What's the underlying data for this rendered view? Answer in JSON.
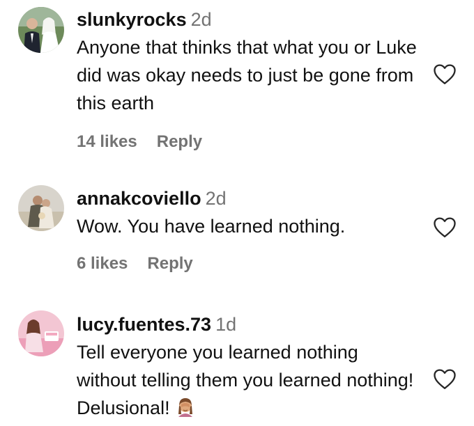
{
  "comments": [
    {
      "username": "slunkyrocks",
      "time": "2d",
      "text": "Anyone that thinks that what you or Luke did was okay needs to just be gone from this earth",
      "likes": "14 likes",
      "reply": "Reply",
      "like_icon": "heart-outline-icon"
    },
    {
      "username": "annakcoviello",
      "time": "2d",
      "text": "Wow. You have learned nothing.",
      "likes": "6 likes",
      "reply": "Reply",
      "like_icon": "heart-outline-icon"
    },
    {
      "username": "lucy.fuentes.73",
      "time": "1d",
      "text": "Tell everyone you learned nothing without telling them you learned nothing! Delusional!",
      "emoji": "person-facepalming-emoji",
      "like_icon": "heart-outline-icon"
    }
  ],
  "colors": {
    "text": "#111111",
    "secondary": "#737373",
    "background": "#ffffff"
  }
}
